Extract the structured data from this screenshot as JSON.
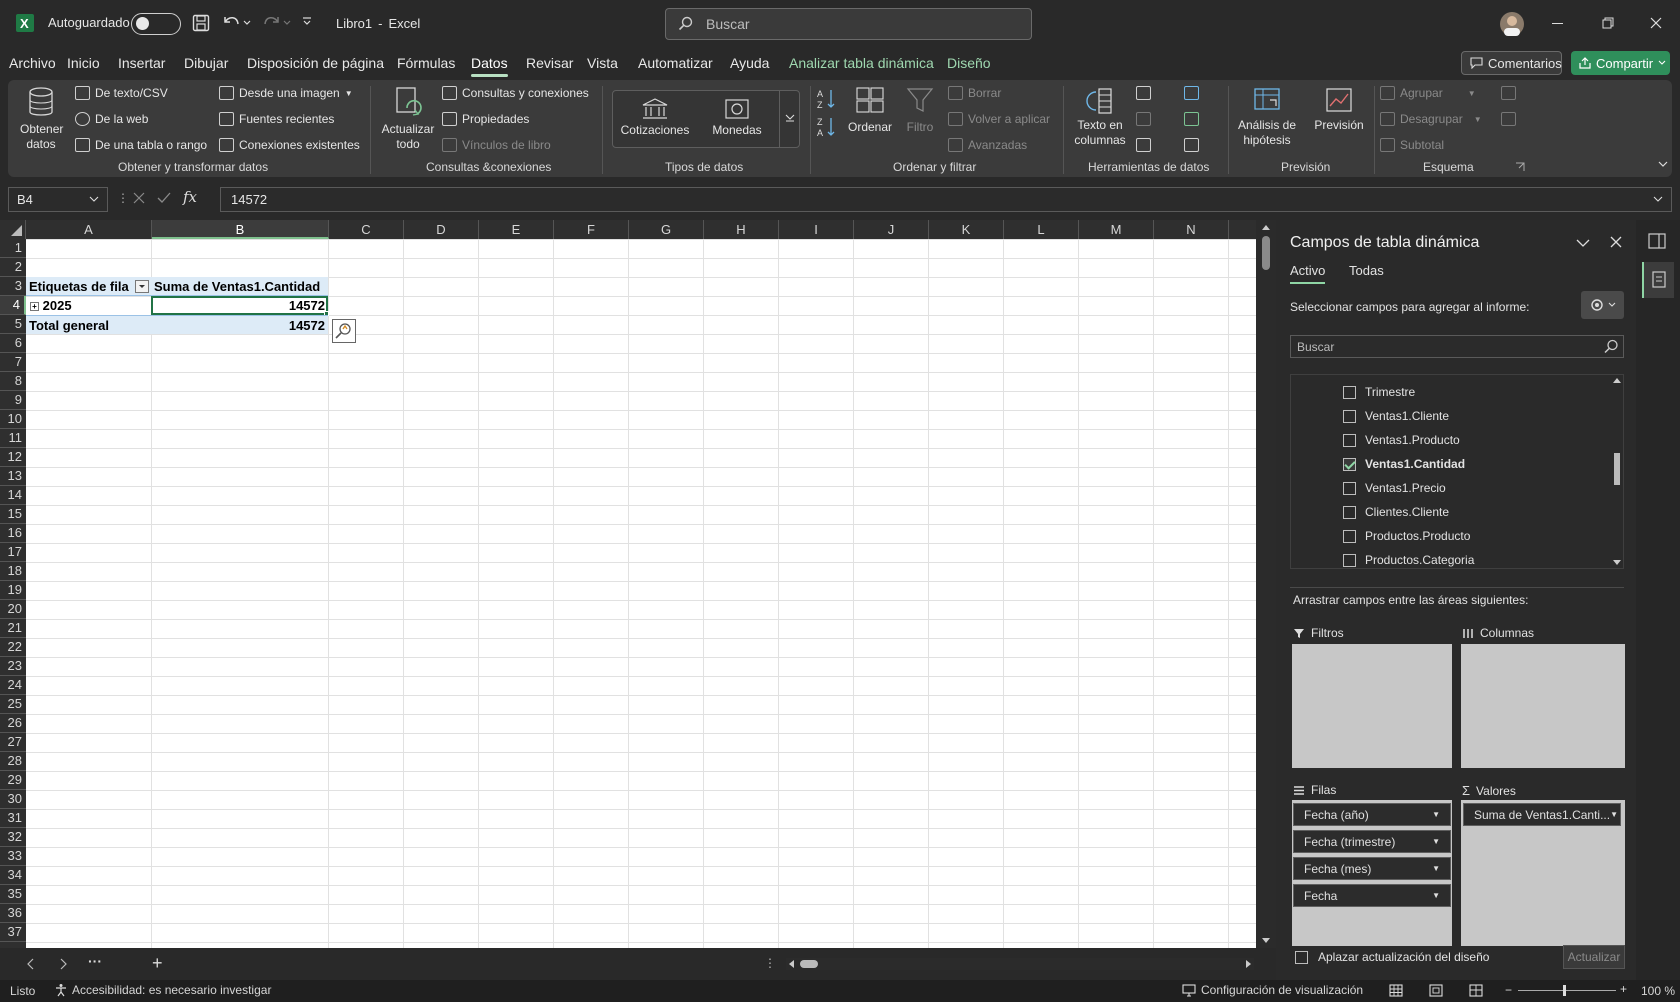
{
  "titlebar": {
    "autosave_label": "Autoguardado",
    "doc_title": "Libro1",
    "app_name": "Excel",
    "title_sep": "-",
    "search_placeholder": "Buscar"
  },
  "menu": {
    "items": [
      "Archivo",
      "Inicio",
      "Insertar",
      "Dibujar",
      "Disposición de página",
      "Fórmulas",
      "Datos",
      "Revisar",
      "Vista",
      "Automatizar",
      "Ayuda",
      "Analizar tabla dinámica",
      "Diseño"
    ],
    "active": "Datos",
    "comments_label": "Comentarios",
    "share_label": "Compartir"
  },
  "ribbon": {
    "get_data": "Obtener datos",
    "from_text": "De texto/CSV",
    "from_web": "De la web",
    "from_table": "De una tabla o rango",
    "from_image": "Desde una imagen",
    "recent_sources": "Fuentes recientes",
    "existing_connections": "Conexiones existentes",
    "group_get": "Obtener y transformar datos",
    "refresh_all": "Actualizar todo",
    "queries_connections": "Consultas y conexiones",
    "properties": "Propiedades",
    "workbook_links": "Vínculos de libro",
    "group_queries": "Consultas &conexiones",
    "stocks": "Cotizaciones",
    "currencies": "Monedas",
    "group_datatypes": "Tipos de datos",
    "sort": "Ordenar",
    "filter": "Filtro",
    "clear": "Borrar",
    "reapply": "Volver a aplicar",
    "advanced": "Avanzadas",
    "group_sort": "Ordenar y filtrar",
    "text_to_columns": "Texto en columnas",
    "group_tools": "Herramientas de datos",
    "what_if": "Análisis de hipótesis",
    "forecast": "Previsión",
    "group_forecast": "Previsión",
    "group_btn": "Agrupar",
    "ungroup_btn": "Desagrupar",
    "subtotal": "Subtotal",
    "group_outline": "Esquema"
  },
  "formula": {
    "name_box": "B4",
    "value": "14572"
  },
  "grid": {
    "columns": [
      "A",
      "B",
      "C",
      "D",
      "E",
      "F",
      "G",
      "H",
      "I",
      "J",
      "K",
      "L",
      "M",
      "N"
    ],
    "rows": [
      "1",
      "2",
      "3",
      "4",
      "5",
      "6",
      "7",
      "8",
      "9",
      "10",
      "11",
      "12",
      "13",
      "14",
      "15",
      "16",
      "17",
      "18",
      "19",
      "20",
      "21",
      "22",
      "23",
      "24",
      "25",
      "26",
      "27",
      "28",
      "29",
      "30",
      "31",
      "32",
      "33",
      "34",
      "35",
      "36",
      "37"
    ],
    "pivot": {
      "row_labels_header": "Etiquetas de fila",
      "value_header": "Suma de Ventas1.Cantidad",
      "row_item": "2025",
      "row_value": "14572",
      "total_label": "Total general",
      "total_value": "14572"
    }
  },
  "statusbar": {
    "ready": "Listo",
    "accessibility": "Accesibilidad: es necesario investigar",
    "display_settings": "Configuración de visualización",
    "zoom": "100 %"
  },
  "pane": {
    "title": "Campos de tabla dinámica",
    "tab_active": "Activo",
    "tab_all": "Todas",
    "choose_fields": "Seleccionar campos para agregar al informe:",
    "search_placeholder": "Buscar",
    "fields": [
      {
        "name": "Trimestre",
        "checked": false
      },
      {
        "name": "Ventas1.Cliente",
        "checked": false
      },
      {
        "name": "Ventas1.Producto",
        "checked": false
      },
      {
        "name": "Ventas1.Cantidad",
        "checked": true
      },
      {
        "name": "Ventas1.Precio",
        "checked": false
      },
      {
        "name": "Clientes.Cliente",
        "checked": false
      },
      {
        "name": "Productos.Producto",
        "checked": false
      },
      {
        "name": "Productos.Categoria",
        "checked": false
      }
    ],
    "drag_hint": "Arrastrar campos entre las áreas siguientes:",
    "filters": "Filtros",
    "columns": "Columnas",
    "rows": "Filas",
    "values": "Valores",
    "row_fields": [
      "Fecha (año)",
      "Fecha (trimestre)",
      "Fecha (mes)",
      "Fecha"
    ],
    "value_fields": [
      "Suma de Ventas1.Canti..."
    ],
    "defer_update": "Aplazar actualización del diseño",
    "update_button": "Actualizar"
  }
}
